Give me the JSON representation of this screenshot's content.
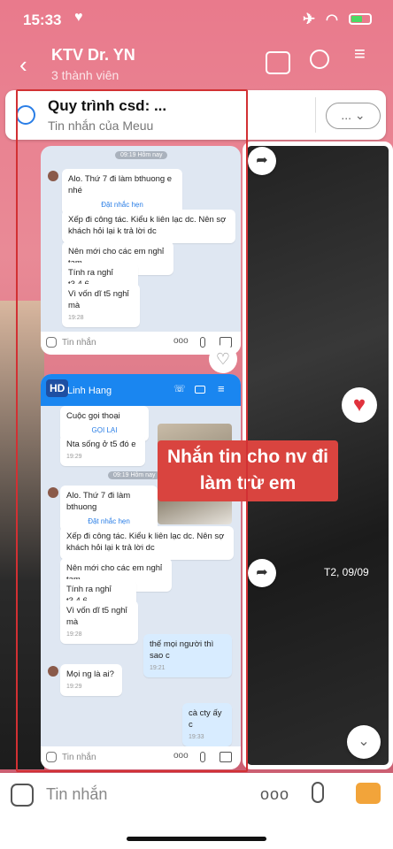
{
  "status": {
    "time": "15:33"
  },
  "header": {
    "title": "KTV Dr. YN",
    "subtitle": "3 thành viên"
  },
  "pinned": {
    "title": "Quy trình csd: ...",
    "subtitle": "Tin nhắn của Meuu",
    "more_label": "..."
  },
  "card1": {
    "date": "09:19 Hôm nay",
    "messages": [
      {
        "text": "Alo. Thứ 7 đi làm bthuong e nhé",
        "link": "Đặt nhắc hẹn"
      },
      {
        "text": "Xếp đi công tác. Kiểu k liên lạc dc. Nên sợ khách hỏi lại k trả lời dc"
      },
      {
        "text": "Nên mới cho các em nghỉ tạm"
      },
      {
        "text": "Tính ra nghỉ t3.4.6"
      },
      {
        "text": "Vì vốn dĩ t5 nghỉ mà",
        "time": "19:28"
      }
    ],
    "input_placeholder": "Tin nhắn"
  },
  "card2": {
    "badge": "HD",
    "contact": "Linh Hang",
    "call_label": "Cuộc gọi thoại",
    "call_back": "GỌI LẠI",
    "top_msg": {
      "text": "Nta sống ở t5 đó e",
      "time": "19:29"
    },
    "date": "09:19 Hôm nay",
    "messages": [
      {
        "text": "Alo. Thứ 7 đi làm bthuong",
        "link": "Đặt nhắc hẹn"
      },
      {
        "text": "Xếp đi công tác. Kiểu k liên lạc dc. Nên sợ khách hỏi lại k trả lời dc"
      },
      {
        "text": "Nên mới cho các em nghỉ tạm"
      },
      {
        "text": "Tính ra nghỉ t3.4.6"
      },
      {
        "text": "Vì vốn dĩ t5 nghỉ mà",
        "time": "19:28"
      }
    ],
    "reply1": {
      "text": "thế mọi người thì sao c",
      "time": "19:21"
    },
    "msg_in": {
      "text": "Mọi ng là ai?",
      "time": "19:29"
    },
    "reply2": {
      "text": "cà cty ấy c",
      "time": "19:33"
    },
    "input_placeholder": "Tin nhắn"
  },
  "caption": "Nhắn tin cho nv đi làm trừ em",
  "datestamp": "T2, 09/09",
  "bottom": {
    "input_placeholder": "Tin nhắn",
    "more": "ooo"
  }
}
